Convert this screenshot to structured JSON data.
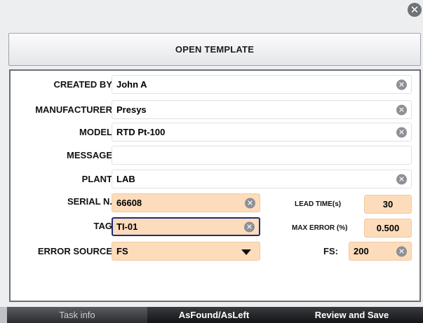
{
  "header": {
    "open_template_label": "OPEN TEMPLATE",
    "close_icon": "close-icon"
  },
  "form": {
    "created_by": {
      "label": "CREATED BY",
      "value": "John A"
    },
    "manufacturer": {
      "label": "MANUFACTURER",
      "value": "Presys"
    },
    "model": {
      "label": "MODEL",
      "value": "RTD Pt-100"
    },
    "message": {
      "label": "MESSAGE",
      "value": ""
    },
    "plant": {
      "label": "PLANT",
      "value": "LAB"
    },
    "serial": {
      "label": "SERIAL N.",
      "value": "66608"
    },
    "tag": {
      "label": "TAG",
      "value": "TI-01"
    },
    "error_source": {
      "label": "ERROR SOURCE",
      "value": "FS"
    },
    "lead_time": {
      "label": "LEAD TIME(s)",
      "value": "30"
    },
    "max_error": {
      "label": "MAX ERROR (%)",
      "value": "0.500"
    },
    "fs": {
      "label": "FS:",
      "value": "200"
    }
  },
  "tabs": [
    {
      "label": "Task info"
    },
    {
      "label": "AsFound/AsLeft"
    },
    {
      "label": "Review and Save"
    }
  ],
  "colors": {
    "peach_field": "#fddcbb",
    "focus_border": "#1d2d7a",
    "panel_border": "#6b6f74"
  }
}
